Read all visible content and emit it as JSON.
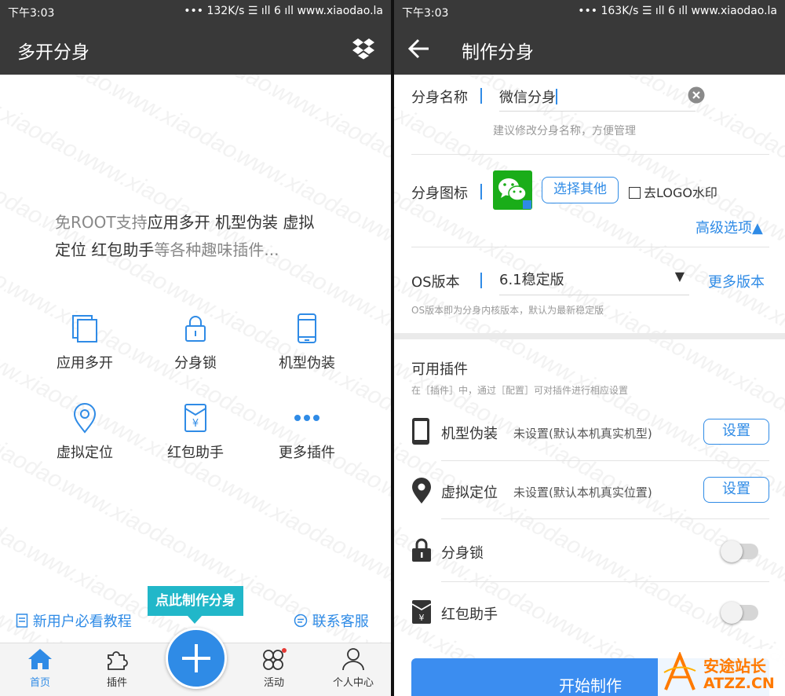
{
  "left": {
    "status": {
      "time": "下午3:03",
      "right": "•••  132K/s  ☰ ıll 6 ıll www.xiaodao.la"
    },
    "title": "多开分身",
    "intro": {
      "normal1": "免ROOT支持",
      "bold1": "应用多开 机型伪装 虚拟",
      "bold2": "定位 红包助手",
      "normal2": "等各种趣味插件..."
    },
    "features": [
      {
        "label": "应用多开",
        "icon": "copy-icon"
      },
      {
        "label": "分身锁",
        "icon": "lock-icon"
      },
      {
        "label": "机型伪装",
        "icon": "phone-icon"
      },
      {
        "label": "虚拟定位",
        "icon": "location-icon"
      },
      {
        "label": "红包助手",
        "icon": "red-packet-icon"
      },
      {
        "label": "更多插件",
        "icon": "more-icon"
      }
    ],
    "tutorial": "新用户必看教程",
    "contact": "联系客服",
    "create_tip": "点此制作分身",
    "tabs": {
      "home": "首页",
      "plugins": "插件",
      "activity": "活动",
      "user": "个人中心"
    }
  },
  "right": {
    "status": {
      "time": "下午3:03",
      "right": "•••  163K/s  ☰ ıll 6 ıll www.xiaodao.la"
    },
    "title": "制作分身",
    "name_label": "分身名称",
    "name_value": "微信分身",
    "name_hint": "建议修改分身名称，方便管理",
    "icon_label": "分身图标",
    "choose_other": "选择其他",
    "remove_logo": "去LOGO水印",
    "advanced": "高级选项▲",
    "os_label": "OS版本",
    "os_value": "6.1稳定版",
    "more_versions": "更多版本",
    "os_hint": "OS版本即为分身内核版本，默认为最新稳定版",
    "plugins_title": "可用插件",
    "plugins_hint": "在［插件］中，通过［配置］可对插件进行相应设置",
    "plugins": [
      {
        "name": "机型伪装",
        "status": "未设置(默认本机真实机型)",
        "action": "设置",
        "icon": "phone-icon"
      },
      {
        "name": "虚拟定位",
        "status": "未设置(默认本机真实位置)",
        "action": "设置",
        "icon": "location-pin-icon"
      },
      {
        "name": "分身锁",
        "icon": "lock-icon"
      },
      {
        "name": "红包助手",
        "icon": "red-packet-icon"
      }
    ],
    "start": "开始制作",
    "logo": {
      "line1": "安途站长",
      "line2": "ATZZ.CN"
    }
  },
  "watermark": "www.xiaodao.la",
  "colors": {
    "bar": "#393939",
    "accent": "#2f8be6",
    "tip": "#21b7c9",
    "brand": "#ff7a00"
  }
}
